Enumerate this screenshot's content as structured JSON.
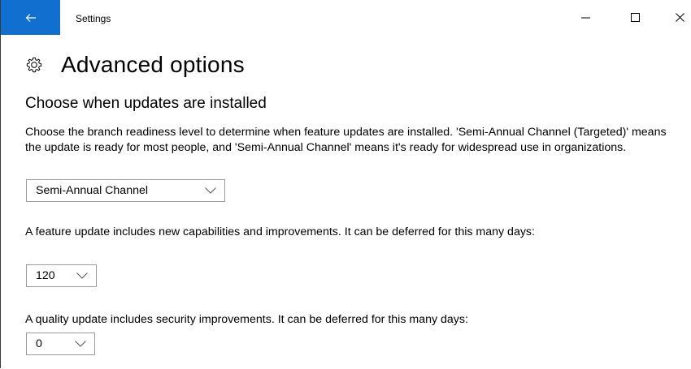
{
  "window": {
    "title": "Settings",
    "accent_color": "#1170cf",
    "back_icon": "back-arrow-icon",
    "minimize_icon": "minimize-icon",
    "maximize_icon": "maximize-icon",
    "close_icon": "close-icon"
  },
  "page": {
    "icon": "gear-icon",
    "title": "Advanced options",
    "section_title": "Choose when updates are installed",
    "branch": {
      "description": "Choose the branch readiness level to determine when feature updates are installed. 'Semi-Annual Channel (Targeted)' means the update is ready for most people, and 'Semi-Annual Channel' means it's ready for widespread use in organizations.",
      "selected": "Semi-Annual Channel"
    },
    "feature_update": {
      "description": "A feature update includes new capabilities and improvements. It can be deferred for this many days:",
      "selected": "120"
    },
    "quality_update": {
      "description": "A quality update includes security improvements. It can be deferred for this many days:",
      "selected": "0"
    }
  }
}
